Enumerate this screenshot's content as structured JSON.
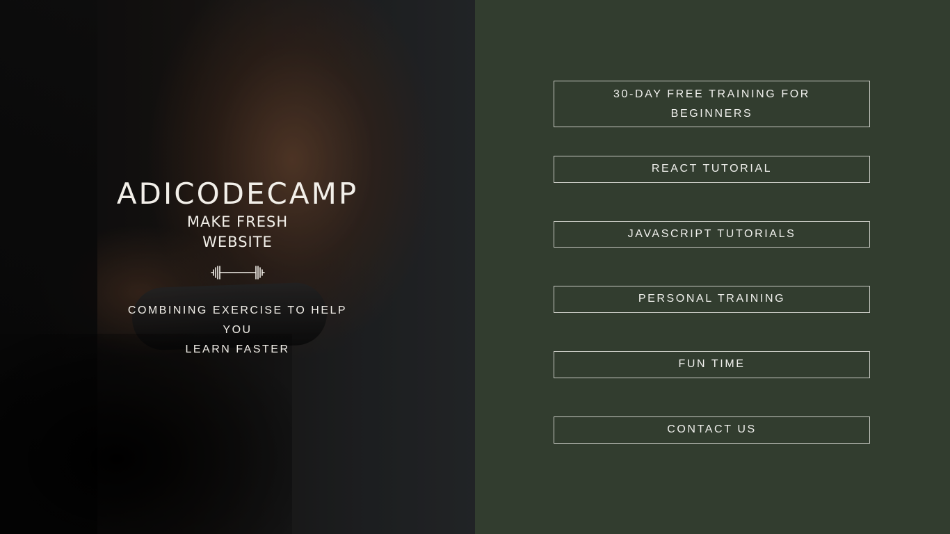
{
  "hero": {
    "brand": "ADICODECAMP",
    "tagline": "MAKE FRESH WEBSITE",
    "icon": "dumbbell-icon",
    "subtext_line1": "COMBINING EXERCISE TO HELP YOU",
    "subtext_line2": "LEARN FASTER"
  },
  "menu": {
    "items": [
      {
        "label": "30-DAY FREE TRAINING FOR BEGINNERS"
      },
      {
        "label": "REACT TUTORIAL"
      },
      {
        "label": "JAVASCRIPT TUTORIALS"
      },
      {
        "label": "PERSONAL TRAINING"
      },
      {
        "label": "FUN TIME"
      },
      {
        "label": "CONTACT US"
      }
    ]
  },
  "colors": {
    "panel_background": "#323d2f",
    "button_border": "#c9cbc4",
    "text": "#f2efe9"
  }
}
